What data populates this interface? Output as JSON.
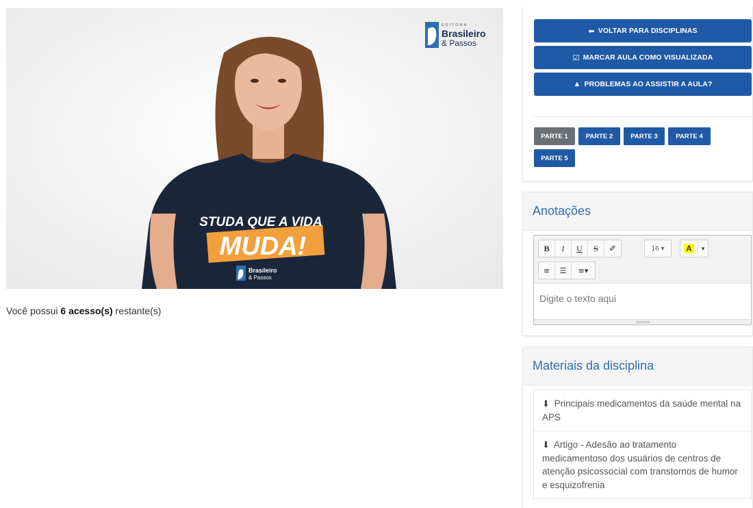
{
  "video": {
    "logo_top": "EDITORA",
    "logo_main": "Brasileiro",
    "logo_sub": "& Passos",
    "shirt_line1": "STUDA QUE A VIDA",
    "shirt_line2": "MUDA!",
    "shirt_logo_main": "Brasileiro",
    "shirt_logo_sub": "& Passos"
  },
  "access": {
    "prefix": "Você possui ",
    "count": "6 acesso(s)",
    "suffix": " restante(s)"
  },
  "actions": {
    "back_icon": "arrow-left-icon",
    "back_label": "VOLTAR PARA DISCIPLINAS",
    "mark_icon": "check-square-icon",
    "mark_label": "MARCAR AULA COMO VISUALIZADA",
    "problem_icon": "warning-icon",
    "problem_label": "PROBLEMAS AO ASSISTIR A AULA?"
  },
  "parts": [
    "PARTE 1",
    "PARTE 2",
    "PARTE 3",
    "PARTE 4",
    "PARTE 5"
  ],
  "active_part": "PARTE 1",
  "notes": {
    "title": "Anotações",
    "font_size": "16",
    "placeholder": "Digite o texto aqui"
  },
  "materials": {
    "title": "Materiais da disciplina",
    "items": [
      "Principais medicamentos da saúde mental na APS",
      "Artigo - Adesão ao tratamento medicamentoso dos usuários de centros de atenção psicossocial com transtornos de humor e esquizofrenia"
    ]
  },
  "colors": {
    "primary": "#1f5aa6",
    "active_part": "#6b7074",
    "heading": "#2f6eb3"
  }
}
